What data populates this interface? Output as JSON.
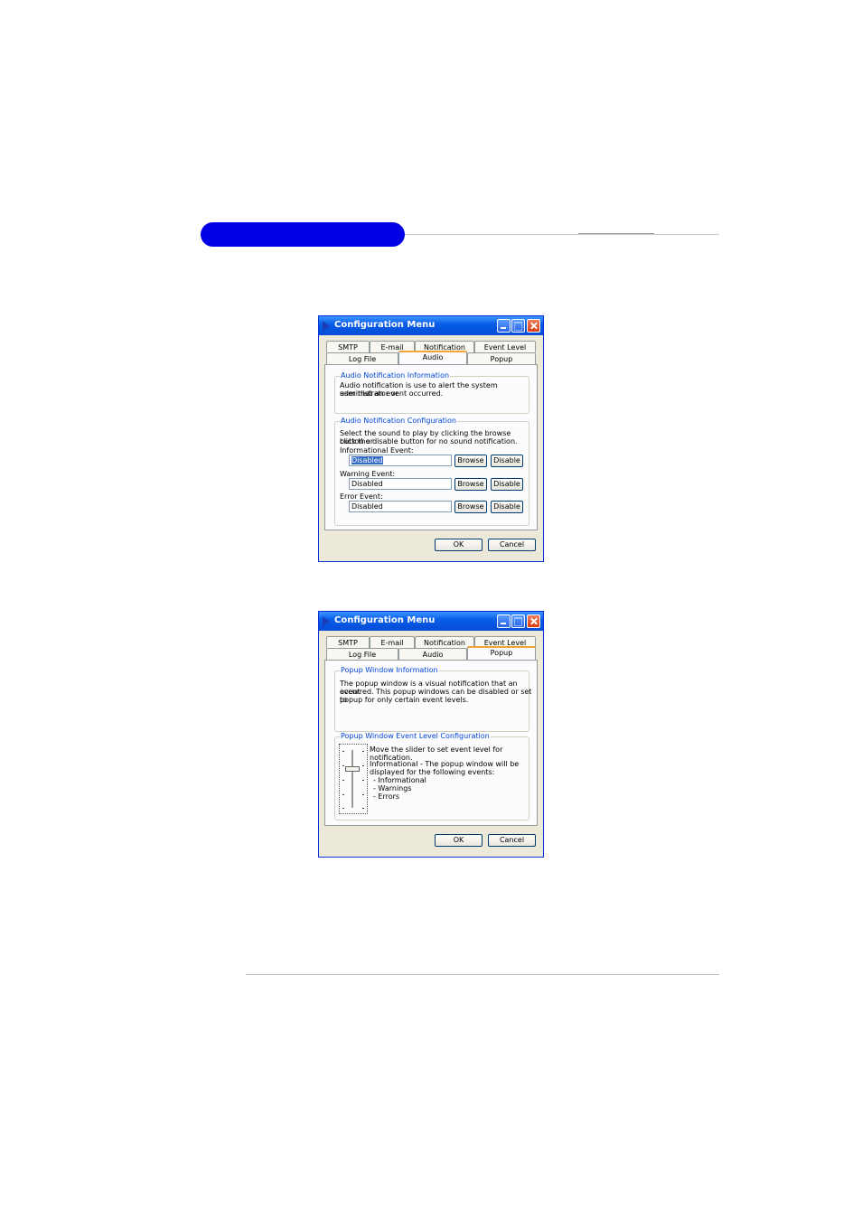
{
  "window_audio": {
    "title": "Configuration Menu",
    "tabs_row1": [
      "SMTP",
      "E-mail",
      "Notification",
      "Event Level"
    ],
    "tabs_row2": [
      "Log File",
      "Audio",
      "Popup"
    ],
    "active_tab": "Audio",
    "info_group": {
      "legend": "Audio Notification Information",
      "line1": "Audio notification is use to alert the system administrator or",
      "line2": "user that an event occurred."
    },
    "config_group": {
      "legend": "Audio Notification Configuration",
      "line1": "Select the sound to play by clicking the browse button or",
      "line2": "click the disable button for no sound notification.",
      "events": [
        {
          "label": "Informational Event:",
          "value": "Disabled",
          "browse": "Browse",
          "disable": "Disable"
        },
        {
          "label": "Warning Event:",
          "value": "Disabled",
          "browse": "Browse",
          "disable": "Disable"
        },
        {
          "label": "Error Event:",
          "value": "Disabled",
          "browse": "Browse",
          "disable": "Disable"
        }
      ]
    },
    "ok": "OK",
    "cancel": "Cancel"
  },
  "window_popup": {
    "title": "Configuration Menu",
    "tabs_row1": [
      "SMTP",
      "E-mail",
      "Notification",
      "Event Level"
    ],
    "tabs_row2": [
      "Log File",
      "Audio",
      "Popup"
    ],
    "active_tab": "Popup",
    "info_group": {
      "legend": "Popup Window Information",
      "line1": "The popup window is a visual notification that an event",
      "line2": "occurred. This popup windows can be disabled or set to",
      "line3": "popup for only certain event levels."
    },
    "level_group": {
      "legend": "Popup Window Event Level Configuration",
      "instruction": "Move the slider to set event level for notification.",
      "desc1": "Informational - The popup window will be",
      "desc2": "displayed for the following events:",
      "items": [
        "- Informational",
        "- Warnings",
        "- Errors"
      ],
      "slider_level": 0.33
    },
    "ok": "OK",
    "cancel": "Cancel"
  }
}
